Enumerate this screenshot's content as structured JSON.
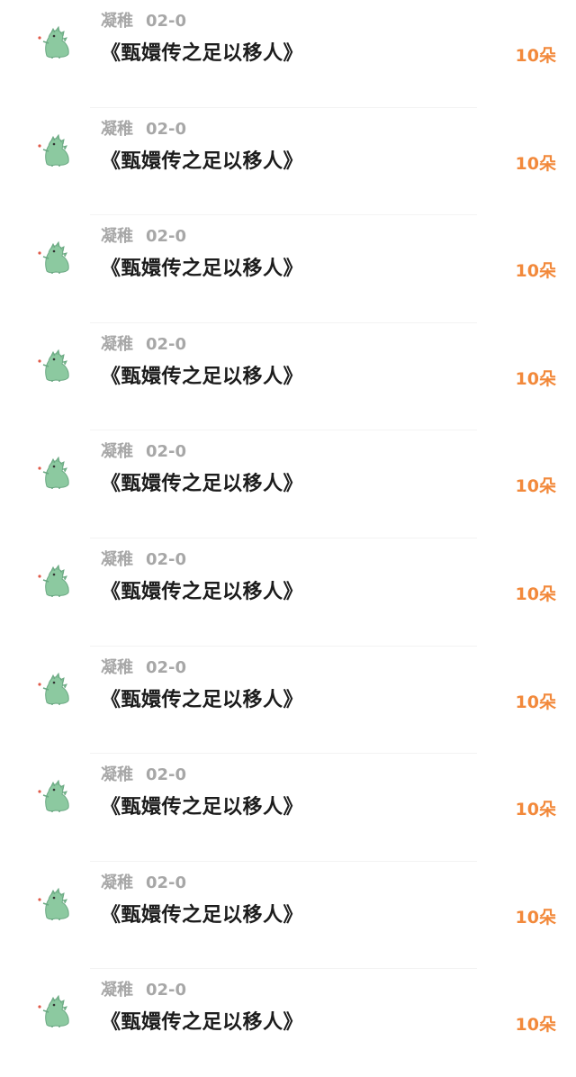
{
  "items": [
    {
      "user": "凝稚",
      "date": "02-0",
      "title": "《甄嬛传之足以移人》",
      "count": "10朵"
    },
    {
      "user": "凝稚",
      "date": "02-0",
      "title": "《甄嬛传之足以移人》",
      "count": "10朵"
    },
    {
      "user": "凝稚",
      "date": "02-0",
      "title": "《甄嬛传之足以移人》",
      "count": "10朵"
    },
    {
      "user": "凝稚",
      "date": "02-0",
      "title": "《甄嬛传之足以移人》",
      "count": "10朵"
    },
    {
      "user": "凝稚",
      "date": "02-0",
      "title": "《甄嬛传之足以移人》",
      "count": "10朵"
    },
    {
      "user": "凝稚",
      "date": "02-0",
      "title": "《甄嬛传之足以移人》",
      "count": "10朵"
    },
    {
      "user": "凝稚",
      "date": "02-0",
      "title": "《甄嬛传之足以移人》",
      "count": "10朵"
    },
    {
      "user": "凝稚",
      "date": "02-0",
      "title": "《甄嬛传之足以移人》",
      "count": "10朵"
    },
    {
      "user": "凝稚",
      "date": "02-0",
      "title": "《甄嬛传之足以移人》",
      "count": "10朵"
    },
    {
      "user": "凝稚",
      "date": "02-0",
      "title": "《甄嬛传之足以移人》",
      "count": "10朵"
    }
  ],
  "avatar_icon": "green-dinosaur-icon",
  "colors": {
    "count": "#f2893b",
    "meta": "#a7a7a7",
    "title": "#1c1c1c",
    "avatar": "#8cc9a0"
  }
}
